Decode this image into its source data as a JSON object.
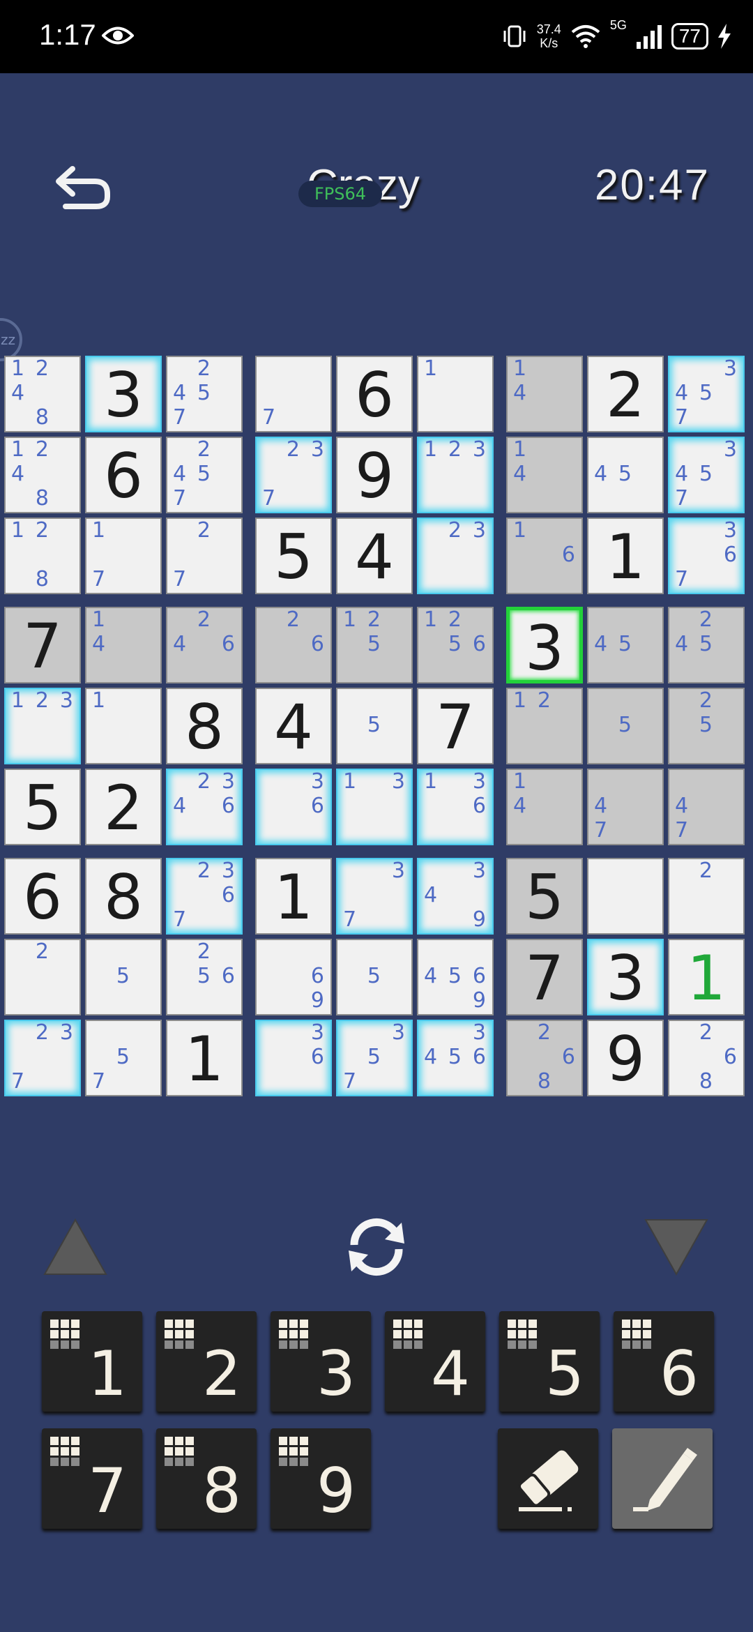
{
  "status_bar": {
    "time": "1:17",
    "net_speed_value": "37.4",
    "net_speed_unit": "K/s",
    "network": "5G",
    "battery": "77"
  },
  "header": {
    "title": "Crazy",
    "fps_overlay": "FPS64",
    "timer": "20:47"
  },
  "side_bubble": "zz",
  "board": {
    "rows": [
      [
        {
          "c": [
            1,
            2,
            4,
            8
          ]
        },
        {
          "v": 3,
          "hl": true
        },
        {
          "c": [
            2,
            4,
            5,
            7
          ]
        },
        {
          "c": [
            7
          ]
        },
        {
          "v": 6
        },
        {
          "c": [
            1
          ]
        },
        {
          "c": [
            1,
            4
          ],
          "shade": true
        },
        {
          "v": 2
        },
        {
          "c": [
            3,
            4,
            5,
            7
          ],
          "hl": true
        }
      ],
      [
        {
          "c": [
            1,
            2,
            4,
            8
          ]
        },
        {
          "v": 6
        },
        {
          "c": [
            2,
            4,
            5,
            7
          ]
        },
        {
          "c": [
            2,
            3,
            7
          ],
          "hl": true
        },
        {
          "v": 9
        },
        {
          "c": [
            1,
            2,
            3
          ],
          "hl": true
        },
        {
          "c": [
            1,
            4
          ],
          "shade": true
        },
        {
          "c": [
            4,
            5
          ]
        },
        {
          "c": [
            3,
            4,
            5,
            7
          ],
          "hl": true
        }
      ],
      [
        {
          "c": [
            1,
            2,
            8
          ]
        },
        {
          "c": [
            1,
            7
          ]
        },
        {
          "c": [
            2,
            7
          ]
        },
        {
          "v": 5
        },
        {
          "v": 4
        },
        {
          "c": [
            2,
            3
          ],
          "hl": true
        },
        {
          "c": [
            1,
            6
          ],
          "shade": true
        },
        {
          "v": 1
        },
        {
          "c": [
            3,
            6,
            7
          ],
          "hl": true
        }
      ],
      [
        {
          "v": 7,
          "shade": true
        },
        {
          "c": [
            1,
            4
          ],
          "shade": true
        },
        {
          "c": [
            2,
            4,
            6
          ],
          "shade": true
        },
        {
          "c": [
            2,
            6
          ],
          "shade": true
        },
        {
          "c": [
            1,
            2,
            5
          ],
          "shade": true
        },
        {
          "c": [
            1,
            2,
            5,
            6
          ],
          "shade": true
        },
        {
          "v": 3,
          "sel": true
        },
        {
          "c": [
            4,
            5
          ],
          "shade": true
        },
        {
          "c": [
            2,
            4,
            5
          ],
          "shade": true
        }
      ],
      [
        {
          "c": [
            1,
            2,
            3
          ],
          "hl": true
        },
        {
          "c": [
            1
          ]
        },
        {
          "v": 8
        },
        {
          "v": 4
        },
        {
          "c": [
            5
          ]
        },
        {
          "v": 7
        },
        {
          "c": [
            1,
            2
          ],
          "shade": true
        },
        {
          "c": [
            5
          ],
          "shade": true
        },
        {
          "c": [
            2,
            5
          ],
          "shade": true
        }
      ],
      [
        {
          "v": 5
        },
        {
          "v": 2
        },
        {
          "c": [
            2,
            3,
            4,
            6
          ],
          "hl": true
        },
        {
          "c": [
            3,
            6
          ],
          "hl": true
        },
        {
          "c": [
            1,
            3
          ],
          "hl": true
        },
        {
          "c": [
            1,
            3,
            6
          ],
          "hl": true
        },
        {
          "c": [
            1,
            4
          ],
          "shade": true
        },
        {
          "c": [
            4,
            7
          ],
          "shade": true
        },
        {
          "c": [
            4,
            7
          ],
          "shade": true
        }
      ],
      [
        {
          "v": 6
        },
        {
          "v": 8
        },
        {
          "c": [
            2,
            3,
            6,
            7
          ],
          "hl": true
        },
        {
          "v": 1
        },
        {
          "c": [
            3,
            7
          ],
          "hl": true
        },
        {
          "c": [
            3,
            4,
            9
          ],
          "hl": true
        },
        {
          "v": 5,
          "shade": true
        },
        {
          "c": []
        },
        {
          "c": [
            2
          ]
        }
      ],
      [
        {
          "c": [
            2
          ]
        },
        {
          "c": [
            5
          ]
        },
        {
          "c": [
            2,
            5,
            6
          ]
        },
        {
          "c": [
            6,
            9
          ]
        },
        {
          "c": [
            5
          ]
        },
        {
          "c": [
            4,
            5,
            6,
            9
          ]
        },
        {
          "v": 7,
          "shade": true
        },
        {
          "v": 3,
          "hl": true
        },
        {
          "v": 1,
          "green": true
        }
      ],
      [
        {
          "c": [
            2,
            3,
            7
          ],
          "hl": true
        },
        {
          "c": [
            5,
            7
          ]
        },
        {
          "v": 1
        },
        {
          "c": [
            3,
            6
          ],
          "hl": true
        },
        {
          "c": [
            3,
            5,
            7
          ],
          "hl": true
        },
        {
          "c": [
            3,
            4,
            5,
            6
          ],
          "hl": true
        },
        {
          "c": [
            2,
            6,
            8
          ],
          "shade": true
        },
        {
          "v": 9
        },
        {
          "c": [
            2,
            6,
            8
          ]
        }
      ]
    ]
  },
  "controls": {
    "up_icon": "triangle-up-icon",
    "refresh_icon": "refresh-icon",
    "down_icon": "triangle-down-icon"
  },
  "keypad": {
    "numbers": [
      "1",
      "2",
      "3",
      "4",
      "5",
      "6",
      "7",
      "8",
      "9"
    ],
    "tools": [
      "eraser-icon",
      "pencil-icon"
    ]
  },
  "colors": {
    "background": "#2f3c66",
    "candidate": "#4e6ac4",
    "highlight": "#56d6f0",
    "selected": "#23d13a",
    "placed_green": "#20a839"
  }
}
